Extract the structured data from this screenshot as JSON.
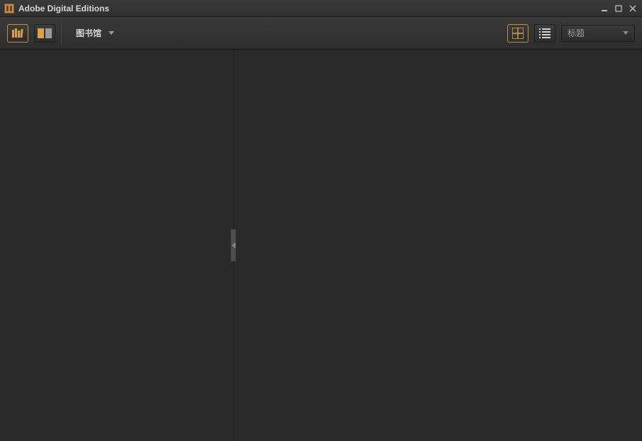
{
  "window": {
    "title": "Adobe Digital Editions"
  },
  "toolbar": {
    "library_menu_label": "图书馆",
    "sort_selected": "标题"
  },
  "icons": {
    "library_view": "library-view-icon",
    "reading_view": "reading-view-icon",
    "thumbnail_view": "thumbnail-view-icon",
    "list_view": "list-view-icon"
  }
}
